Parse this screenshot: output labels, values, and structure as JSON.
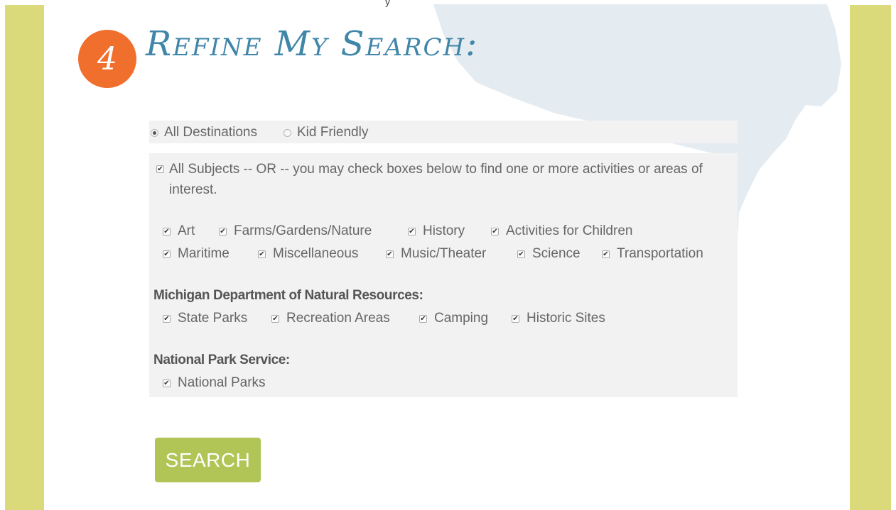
{
  "header": {
    "step_number": "4",
    "title": "Refine My Search:",
    "top_fragment": "y"
  },
  "destination_filter": {
    "options": [
      {
        "label": "All Destinations",
        "selected": true
      },
      {
        "label": "Kid Friendly",
        "selected": false
      }
    ]
  },
  "subjects": {
    "all_label": "All Subjects -- OR -- you may check boxes below to find one or more activities or areas of interest.",
    "all_checked": true,
    "items": [
      {
        "label": "Art",
        "checked": true
      },
      {
        "label": "Farms/Gardens/Nature",
        "checked": true
      },
      {
        "label": "History",
        "checked": true
      },
      {
        "label": "Activities for Children",
        "checked": true
      },
      {
        "label": "Maritime",
        "checked": true
      },
      {
        "label": "Miscellaneous",
        "checked": true
      },
      {
        "label": "Music/Theater",
        "checked": true
      },
      {
        "label": "Science",
        "checked": true
      },
      {
        "label": "Transportation",
        "checked": true
      }
    ]
  },
  "dnr": {
    "heading": "Michigan Department of Natural Resources:",
    "items": [
      {
        "label": "State Parks",
        "checked": true
      },
      {
        "label": "Recreation Areas",
        "checked": true
      },
      {
        "label": "Camping",
        "checked": true
      },
      {
        "label": "Historic Sites",
        "checked": true
      }
    ]
  },
  "nps": {
    "heading": "National Park Service:",
    "items": [
      {
        "label": "National Parks",
        "checked": true
      }
    ]
  },
  "search_button": {
    "label": "SEARCH"
  },
  "check_glyph": "✔",
  "colors": {
    "side_bar": "#dbda7a",
    "step_circle": "#f06f2d",
    "title": "#3f86a8",
    "map_shape": "#e4ecf2",
    "panel": "#f2f2f2",
    "search_button": "#b0c556"
  }
}
